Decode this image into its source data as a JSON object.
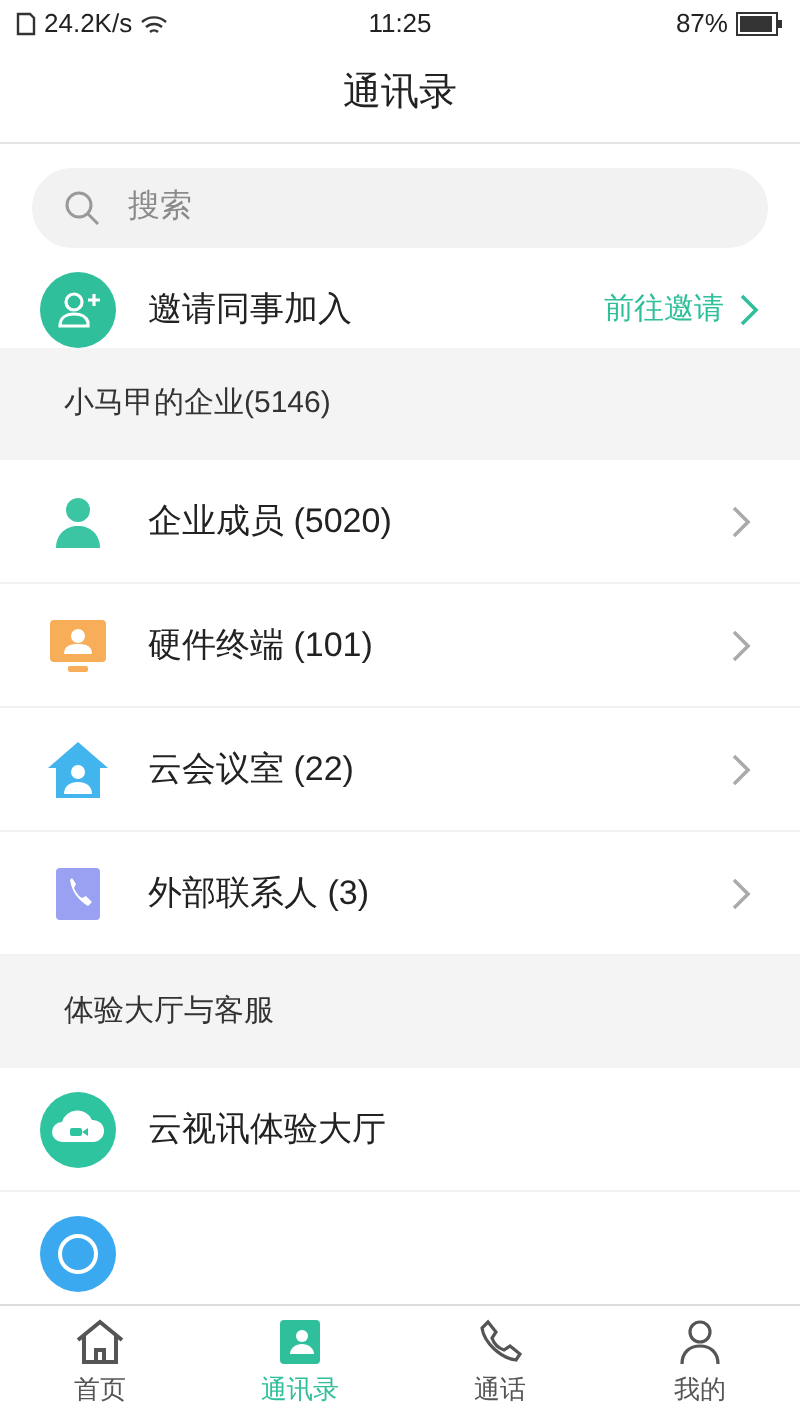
{
  "status_bar": {
    "speed": "24.2K/s",
    "time": "11:25",
    "battery": "87%"
  },
  "header": {
    "title": "通讯录"
  },
  "search": {
    "placeholder": "搜索"
  },
  "invite": {
    "label": "邀请同事加入",
    "action": "前往邀请"
  },
  "sections": [
    {
      "title": "小马甲的企业(5146)",
      "items": [
        {
          "kind": "member",
          "label": "企业成员 (5020)",
          "chevron": true
        },
        {
          "kind": "device",
          "label": "硬件终端 (101)",
          "chevron": true
        },
        {
          "kind": "room",
          "label": "云会议室 (22)",
          "chevron": true
        },
        {
          "kind": "contact",
          "label": "外部联系人 (3)",
          "chevron": true
        }
      ]
    },
    {
      "title": "体验大厅与客服",
      "items": [
        {
          "kind": "cloud",
          "label": "云视讯体验大厅",
          "chevron": false
        },
        {
          "kind": "service",
          "chevron": false
        }
      ]
    }
  ],
  "tabs": [
    {
      "kind": "home",
      "label": "首页",
      "selected": false
    },
    {
      "kind": "contacts",
      "label": "通讯录",
      "selected": true
    },
    {
      "kind": "phone",
      "label": "通话",
      "selected": false
    },
    {
      "kind": "me",
      "label": "我的",
      "selected": false
    }
  ]
}
